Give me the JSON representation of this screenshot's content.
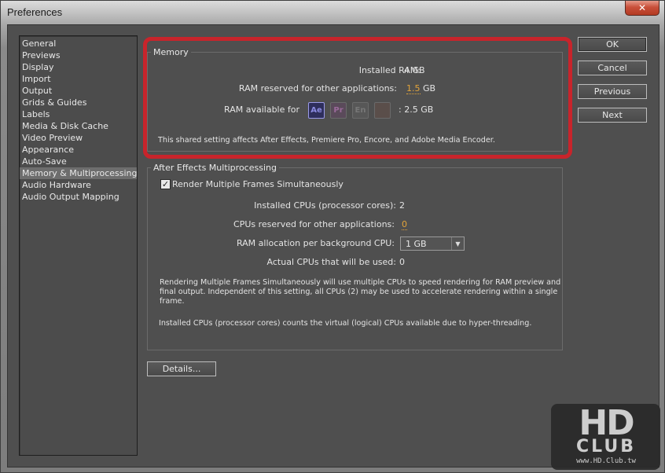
{
  "window": {
    "title": "Preferences",
    "close_glyph": "✕"
  },
  "sidebar": {
    "items": [
      {
        "label": "General"
      },
      {
        "label": "Previews"
      },
      {
        "label": "Display"
      },
      {
        "label": "Import"
      },
      {
        "label": "Output"
      },
      {
        "label": "Grids & Guides"
      },
      {
        "label": "Labels"
      },
      {
        "label": "Media & Disk Cache"
      },
      {
        "label": "Video Preview"
      },
      {
        "label": "Appearance"
      },
      {
        "label": "Auto-Save"
      },
      {
        "label": "Memory & Multiprocessing",
        "selected": true
      },
      {
        "label": "Audio Hardware"
      },
      {
        "label": "Audio Output Mapping"
      }
    ]
  },
  "buttons": {
    "ok": "OK",
    "cancel": "Cancel",
    "previous": "Previous",
    "next": "Next",
    "details": "Details..."
  },
  "memory": {
    "group_title": "Memory",
    "installed_ram_label": "Installed RAM:",
    "installed_ram_value": "4 GB",
    "reserved_label": "RAM reserved for other applications:",
    "reserved_value": "1.5",
    "reserved_unit": "GB",
    "available_label": "RAM available for",
    "available_value": ": 2.5 GB",
    "apps": [
      {
        "icon": "after-effects-icon",
        "text": "Ae",
        "color": "#8a8ae0",
        "bg": "#2e2e5c",
        "active": true
      },
      {
        "icon": "premiere-pro-icon",
        "text": "Pr",
        "color": "#9a6a9a",
        "bg": "#5a4a5a",
        "active": false
      },
      {
        "icon": "encore-icon",
        "text": "En",
        "color": "#777777",
        "bg": "#575757",
        "active": false
      },
      {
        "icon": "media-encoder-icon",
        "text": "",
        "color": "#8a6a5a",
        "bg": "#5a4e4a",
        "active": false
      }
    ],
    "note": "This shared setting affects After Effects, Premiere Pro, Encore, and Adobe Media Encoder.",
    "highlight_color": "#c8242b"
  },
  "multiprocessing": {
    "group_title": "After Effects Multiprocessing",
    "render_multiple_label": "Render Multiple Frames Simultaneously",
    "render_multiple_checked": true,
    "check_glyph": "✓",
    "installed_cpus_label": "Installed CPUs (processor cores):",
    "installed_cpus_value": "2",
    "reserved_cpus_label": "CPUs reserved for other applications:",
    "reserved_cpus_value": "0",
    "ram_alloc_label": "RAM allocation per background CPU:",
    "ram_alloc_value": "1 GB",
    "actual_cpus_label": "Actual CPUs that will be used:",
    "actual_cpus_value": "0",
    "note1_line1": "Rendering Multiple Frames Simultaneously will use multiple CPUs to speed rendering for RAM preview and",
    "note1_line2": "final output. Independent of this setting, all CPUs (2) may be used to accelerate rendering within a single",
    "note1_line3": "frame.",
    "note2": "Installed CPUs (processor cores) counts the virtual (logical) CPUs available due to hyper-threading."
  },
  "watermark": {
    "big": "HD",
    "club": "CLUB",
    "url": "www.HD.Club.tw"
  }
}
